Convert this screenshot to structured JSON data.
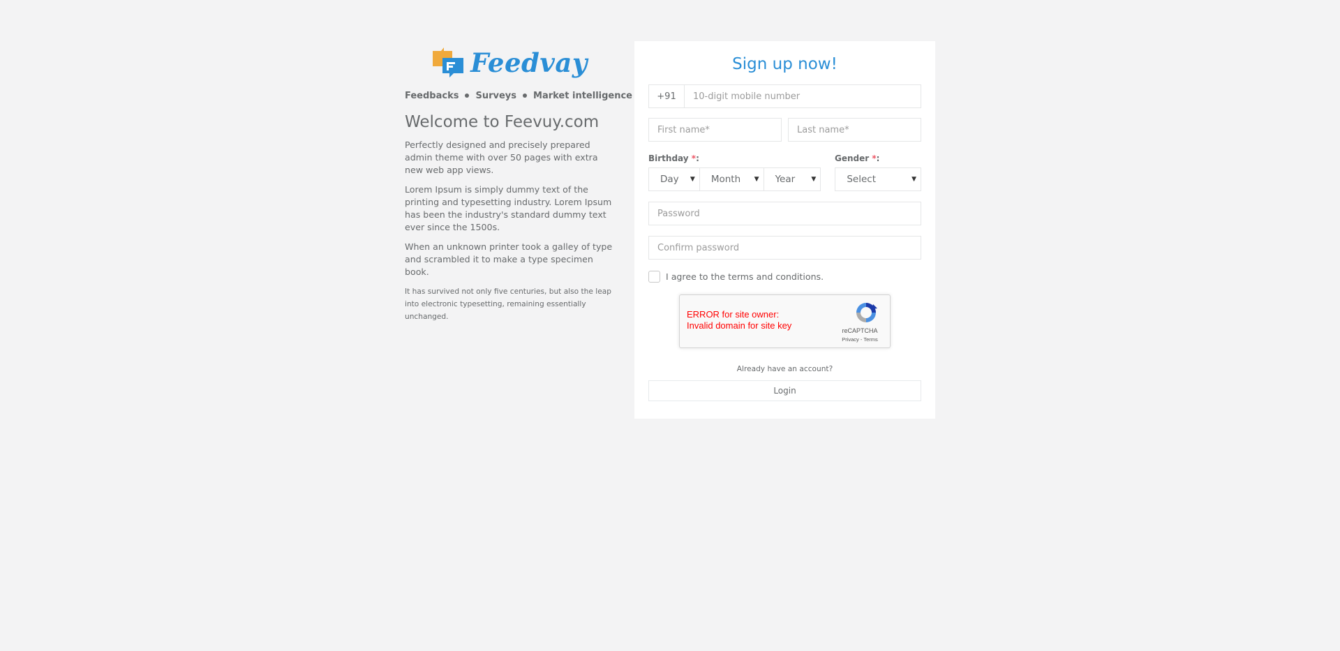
{
  "brand": {
    "name": "Feedvay",
    "colors": {
      "primary": "#2a8ed6",
      "accent_orange": "#f0a93b",
      "required": "#ed5565",
      "error": "#ff0000"
    }
  },
  "tagline": {
    "item1": "Feedbacks",
    "item2": "Surveys",
    "item3": "Market intelligence"
  },
  "welcome": {
    "title": "Welcome to Feevuy.com",
    "p1": "Perfectly designed and precisely prepared admin theme with over 50 pages with extra new web app views.",
    "p2": "Lorem Ipsum is simply dummy text of the printing and typesetting industry. Lorem Ipsum has been the industry's standard dummy text ever since the 1500s.",
    "p3": "When an unknown printer took a galley of type and scrambled it to make a type specimen book.",
    "p4": "It has survived not only five centuries, but also the leap into electronic typesetting, remaining essentially unchanged."
  },
  "form": {
    "title": "Sign up now!",
    "phone_prefix": "+91",
    "phone_placeholder": "10-digit mobile number",
    "first_name_placeholder": "First name*",
    "last_name_placeholder": "Last name*",
    "birthday_label": "Birthday",
    "gender_label": "Gender",
    "required_mark": "*",
    "label_colon": ":",
    "day_value": "Day",
    "month_value": "Month",
    "year_value": "Year",
    "gender_value": "Select",
    "password_placeholder": "Password",
    "confirm_password_placeholder": "Confirm password",
    "agree_text": "I agree to the terms and conditions.",
    "already_text": "Already have an account?",
    "login_label": "Login"
  },
  "recaptcha": {
    "error_line1": "ERROR for site owner:",
    "error_line2": "Invalid domain for site key",
    "brand": "reCAPTCHA",
    "privacy": "Privacy",
    "separator": " - ",
    "terms": "Terms"
  },
  "icons": {
    "logo": "chat-bubbles-logo-icon",
    "select_caret": "caret-down-icon",
    "recaptcha": "recaptcha-logo-icon"
  }
}
